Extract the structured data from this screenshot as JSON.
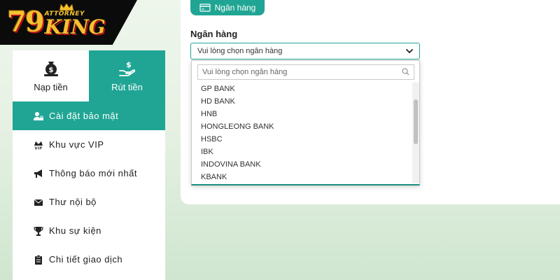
{
  "logo": {
    "number": "79",
    "small": "ATTORNEY",
    "big": "KING"
  },
  "tabs": {
    "deposit": "Nạp tiền",
    "withdraw": "Rút tiền"
  },
  "menu": [
    {
      "label": "Cài đặt bảo mật",
      "icon": "user-lock-icon",
      "active": true
    },
    {
      "label": "Khu vực VIP",
      "icon": "vip-crown-icon"
    },
    {
      "label": "Thông báo mới nhất",
      "icon": "bullhorn-icon"
    },
    {
      "label": "Thư nội bộ",
      "icon": "envelope-icon"
    },
    {
      "label": "Khu sự kiện",
      "icon": "trophy-icon"
    },
    {
      "label": "Chi tiết giao dịch",
      "icon": "clipboard-icon"
    }
  ],
  "bank_tab": {
    "label": "Ngân hàng",
    "icon": "bank-card-icon"
  },
  "form": {
    "bank_label": "Ngân hàng",
    "bank_select_value": "Vui lòng chọn ngân hàng"
  },
  "dropdown": {
    "search_placeholder": "Vui lòng chọn ngân hàng",
    "options": [
      "GP BANK",
      "HD BANK",
      "HNB",
      "HONGLEONG BANK",
      "HSBC",
      "IBK",
      "INDOVINA BANK",
      "KBANK"
    ]
  },
  "colors": {
    "accent": "#20a594",
    "logo_gold": "#f2c230",
    "logo_red": "#b8121b"
  }
}
